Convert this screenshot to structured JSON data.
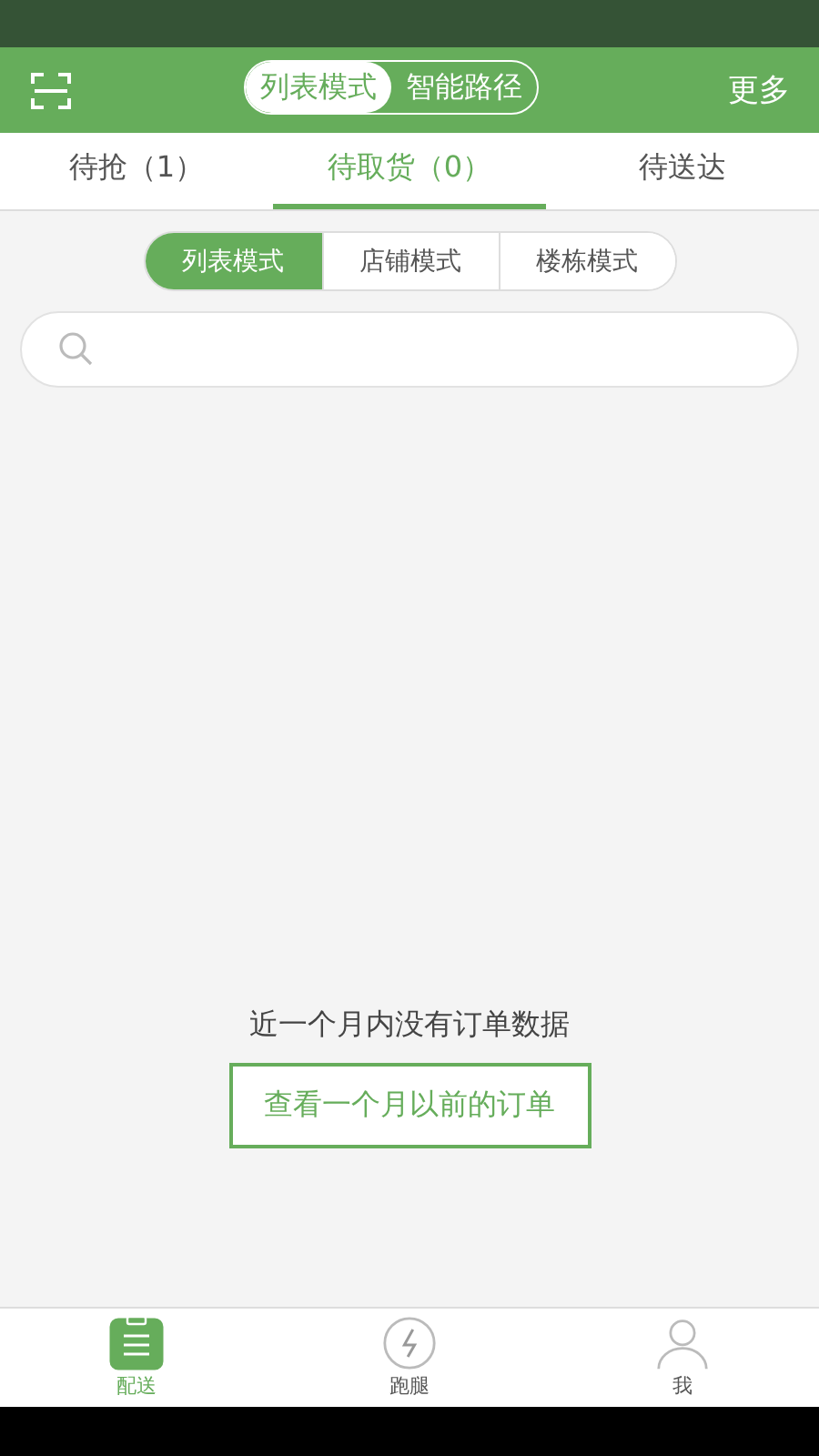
{
  "header": {
    "modes": [
      {
        "label": "列表模式",
        "selected": true
      },
      {
        "label": "智能路径",
        "selected": false
      }
    ],
    "more": "更多"
  },
  "tabs": [
    {
      "label": "待抢（1）",
      "selected": false
    },
    {
      "label": "待取货（0）",
      "selected": true
    },
    {
      "label": "待送达",
      "selected": false
    }
  ],
  "view_modes": [
    {
      "label": "列表模式",
      "selected": true
    },
    {
      "label": "店铺模式",
      "selected": false
    },
    {
      "label": "楼栋模式",
      "selected": false
    }
  ],
  "empty": {
    "message": "近一个月内没有订单数据",
    "button": "查看一个月以前的订单"
  },
  "bottom_nav": [
    {
      "kind": "orders",
      "label": "配送",
      "selected": true
    },
    {
      "kind": "errand",
      "label": "跑腿",
      "selected": false
    },
    {
      "kind": "profile",
      "label": "我",
      "selected": false
    }
  ]
}
